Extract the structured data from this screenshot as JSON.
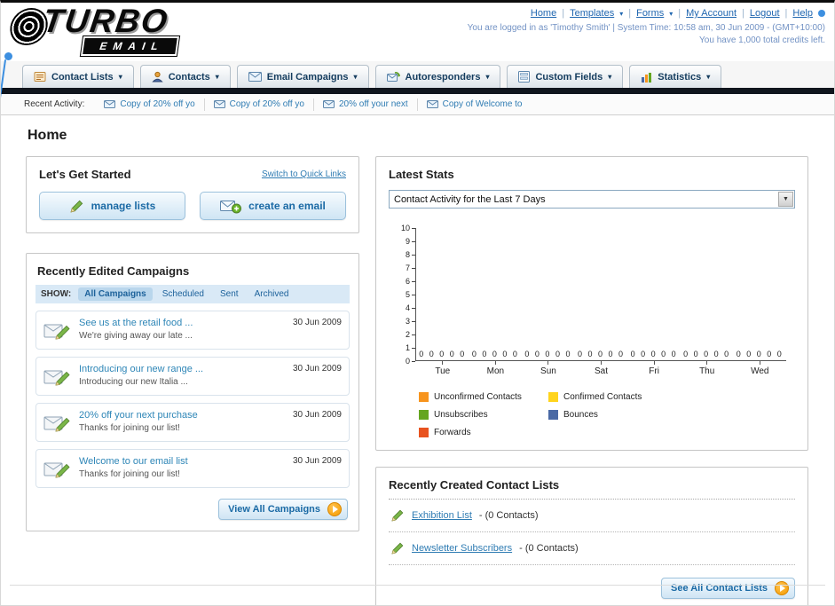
{
  "header": {
    "logo_line1": "TURBO",
    "logo_line2": "EMAIL",
    "links": [
      {
        "label": "Home",
        "dropdown": false
      },
      {
        "label": "Templates",
        "dropdown": true
      },
      {
        "label": "Forms",
        "dropdown": true
      },
      {
        "label": "My Account",
        "dropdown": false
      },
      {
        "label": "Logout",
        "dropdown": false
      },
      {
        "label": "Help",
        "dropdown": false
      }
    ],
    "session_line": "You are logged in as 'Timothy Smith' | System Time: 10:58 am, 30 Jun 2009 - (GMT+10:00)",
    "credits_line": "You have 1,000 total credits left."
  },
  "nav": {
    "items": [
      {
        "label": "Contact Lists"
      },
      {
        "label": "Contacts"
      },
      {
        "label": "Email Campaigns"
      },
      {
        "label": "Autoresponders"
      },
      {
        "label": "Custom Fields"
      },
      {
        "label": "Statistics"
      }
    ]
  },
  "recent_activity": {
    "label": "Recent Activity:",
    "items": [
      {
        "text": "Copy of 20% off yo"
      },
      {
        "text": "Copy of 20% off yo"
      },
      {
        "text": "20% off your next"
      },
      {
        "text": "Copy of Welcome to"
      }
    ]
  },
  "page": {
    "title": "Home"
  },
  "get_started": {
    "title": "Let's Get Started",
    "switch_link": "Switch to Quick Links",
    "manage_lists_button": "manage lists",
    "create_email_button": "create an email"
  },
  "campaigns": {
    "title": "Recently Edited Campaigns",
    "show_label": "SHOW:",
    "tabs": [
      {
        "label": "All Campaigns"
      },
      {
        "label": "Scheduled"
      },
      {
        "label": "Sent"
      },
      {
        "label": "Archived"
      }
    ],
    "items": [
      {
        "title": "See us at the retail food ...",
        "subtitle": "We're giving away our late ...",
        "date": "30 Jun 2009"
      },
      {
        "title": "Introducing our new range ...",
        "subtitle": "Introducing our new Italia ...",
        "date": "30 Jun 2009"
      },
      {
        "title": "20% off your next purchase",
        "subtitle": "Thanks for joining our list!",
        "date": "30 Jun 2009"
      },
      {
        "title": "Welcome to our email list",
        "subtitle": "Thanks for joining our list!",
        "date": "30 Jun 2009"
      }
    ],
    "view_all_button": "View All Campaigns"
  },
  "stats": {
    "title": "Latest Stats",
    "dropdown_value": "Contact Activity for the Last 7 Days",
    "chart_data": {
      "type": "bar",
      "title": "Contact Activity for the Last 7 Days",
      "categories": [
        "Tue",
        "Mon",
        "Sun",
        "Sat",
        "Fri",
        "Thu",
        "Wed"
      ],
      "series": [
        {
          "name": "Unconfirmed Contacts",
          "color": "#f7941d",
          "values": [
            0,
            0,
            0,
            0,
            0,
            0,
            0
          ]
        },
        {
          "name": "Confirmed Contacts",
          "color": "#ffd41d",
          "values": [
            0,
            0,
            0,
            0,
            0,
            0,
            0
          ]
        },
        {
          "name": "Unsubscribes",
          "color": "#64a520",
          "values": [
            0,
            0,
            0,
            0,
            0,
            0,
            0
          ]
        },
        {
          "name": "Bounces",
          "color": "#4a69a5",
          "values": [
            0,
            0,
            0,
            0,
            0,
            0,
            0
          ]
        },
        {
          "name": "Forwards",
          "color": "#e8531f",
          "values": [
            0,
            0,
            0,
            0,
            0,
            0,
            0
          ]
        }
      ],
      "ylim": [
        0,
        10
      ],
      "yticks": [
        10,
        9,
        8,
        7,
        6,
        5,
        4,
        3,
        2,
        1,
        0
      ],
      "grid": false,
      "legend_position": "bottom"
    }
  },
  "contact_lists": {
    "title": "Recently Created Contact Lists",
    "items": [
      {
        "name": "Exhibition List",
        "detail": "- (0 Contacts)"
      },
      {
        "name": "Newsletter Subscribers",
        "detail": "- (0 Contacts)"
      }
    ],
    "see_all_button": "See All Contact Lists"
  },
  "colors": {
    "accent_blue": "#1f66b0",
    "dark_bar": "#10151d",
    "button_text": "#1b6aa5",
    "orange": "#f59b00"
  }
}
